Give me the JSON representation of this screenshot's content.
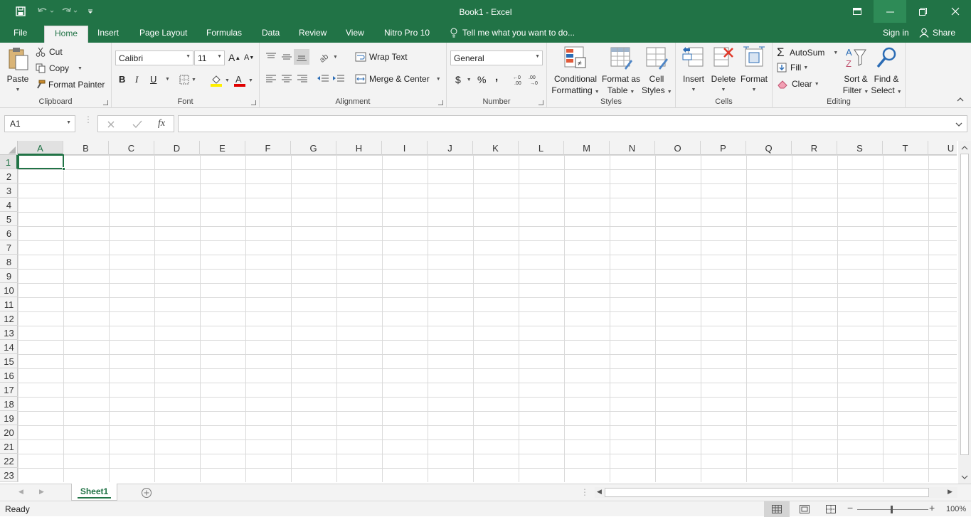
{
  "window": {
    "title": "Book1 - Excel",
    "controls": [
      "ribbon-display-icon",
      "minimize-icon",
      "restore-icon",
      "close-icon"
    ]
  },
  "tabs": [
    "File",
    "Home",
    "Insert",
    "Page Layout",
    "Formulas",
    "Data",
    "Review",
    "View",
    "Nitro Pro 10"
  ],
  "active_tab": "Home",
  "tell_me": "Tell me what you want to do...",
  "sign_in": "Sign in",
  "share": "Share",
  "clipboard": {
    "label": "Clipboard",
    "paste": "Paste",
    "cut": "Cut",
    "copy": "Copy",
    "format_painter": "Format Painter"
  },
  "font": {
    "label": "Font",
    "name": "Calibri",
    "size": "11",
    "bold": "B",
    "italic": "I",
    "underline": "U"
  },
  "alignment": {
    "label": "Alignment",
    "wrap_text": "Wrap Text",
    "merge_center": "Merge & Center"
  },
  "number": {
    "label": "Number",
    "format": "General",
    "currency": "$",
    "percent": "%",
    "comma": ","
  },
  "styles": {
    "label": "Styles",
    "conditional_1": "Conditional",
    "conditional_2": "Formatting",
    "format_table_1": "Format as",
    "format_table_2": "Table",
    "cell_styles_1": "Cell",
    "cell_styles_2": "Styles"
  },
  "cells_group": {
    "label": "Cells",
    "insert": "Insert",
    "delete": "Delete",
    "format": "Format"
  },
  "editing": {
    "label": "Editing",
    "autosum": "AutoSum",
    "fill": "Fill",
    "clear": "Clear",
    "sort_1": "Sort &",
    "sort_2": "Filter",
    "find_1": "Find &",
    "find_2": "Select"
  },
  "formula_bar": {
    "name_box": "A1",
    "value": "",
    "fx": "fx"
  },
  "grid": {
    "columns": [
      "A",
      "B",
      "C",
      "D",
      "E",
      "F",
      "G",
      "H",
      "I",
      "J",
      "K",
      "L",
      "M",
      "N",
      "O",
      "P",
      "Q",
      "R",
      "S",
      "T",
      "U"
    ],
    "rows": [
      "1",
      "2",
      "3",
      "4",
      "5",
      "6",
      "7",
      "8",
      "9",
      "10",
      "11",
      "12",
      "13",
      "14",
      "15",
      "16",
      "17",
      "18",
      "19",
      "20",
      "21",
      "22",
      "23"
    ],
    "selected_cell": "A1"
  },
  "sheets": [
    "Sheet1"
  ],
  "status": {
    "text": "Ready",
    "zoom": "100%"
  },
  "colors": {
    "brand": "#217346",
    "ribbon_bg": "#f3f3f3"
  }
}
